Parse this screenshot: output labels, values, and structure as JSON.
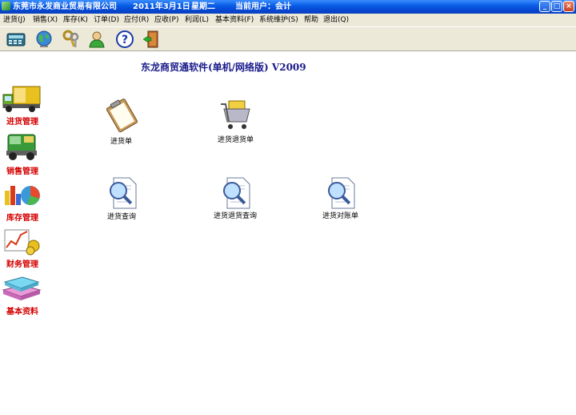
{
  "window": {
    "title": "东莞市永发商业贸易有限公司",
    "date": "2011年3月1日",
    "weekday": "星期二",
    "current_user": "当前用户：会计"
  },
  "menu": [
    "进货(J)",
    "销售(X)",
    "库存(K)",
    "订单(D)",
    "应付(R)",
    "应收(P)",
    "利润(L)",
    "基本资料(F)",
    "系统维护(S)",
    "帮助",
    "退出(Q)"
  ],
  "toolbar": [
    "calculator-icon",
    "globe-icon",
    "keys-icon",
    "user-icon",
    "help-icon",
    "exit-icon"
  ],
  "app_title": "东龙商贸通软件(单机/网络版)   V2009",
  "nav": [
    {
      "label": "进货管理",
      "icon": "truck-icon"
    },
    {
      "label": "销售管理",
      "icon": "sales-truck-icon"
    },
    {
      "label": "库存管理",
      "icon": "pie-chart-icon"
    },
    {
      "label": "财务管理",
      "icon": "finance-chart-icon"
    },
    {
      "label": "基本资料",
      "icon": "stack-icon"
    }
  ],
  "functions": [
    {
      "label": "进货单",
      "icon": "clipboard-icon"
    },
    {
      "label": "进货退货单",
      "icon": "cart-icon"
    },
    {
      "label": "进货查询",
      "icon": "search-doc-icon"
    },
    {
      "label": "进货退货查询",
      "icon": "search-doc-icon"
    },
    {
      "label": "进货对账单",
      "icon": "search-doc-icon"
    }
  ],
  "colors": {
    "title_bar": "#0a5fe6",
    "menu_bg": "#ece9d8",
    "nav_label": "#d40000",
    "app_title": "#1a1a8c"
  }
}
